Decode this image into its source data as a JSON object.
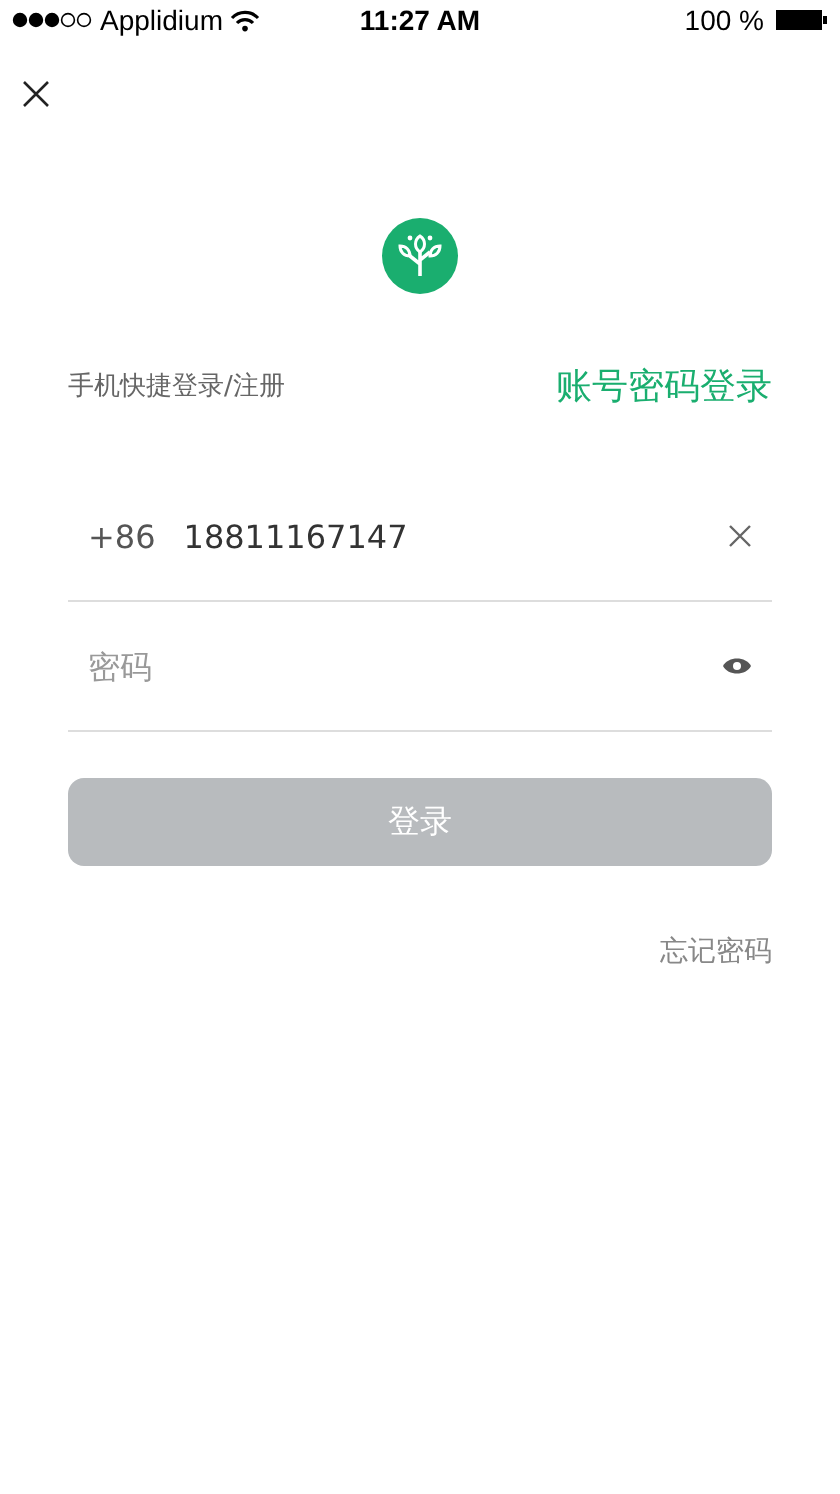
{
  "status_bar": {
    "carrier": "Applidium",
    "time": "11:27 AM",
    "battery": "100 %"
  },
  "tabs": [
    {
      "label": "手机快捷登录/注册",
      "selected": false
    },
    {
      "label": "账号密码登录",
      "selected": true
    }
  ],
  "phone_field": {
    "country_code": "+86",
    "value": "18811167147"
  },
  "password_field": {
    "placeholder": "密码"
  },
  "login_button": {
    "label": "登录",
    "disabled": true
  },
  "forgot_link": "忘记密码"
}
